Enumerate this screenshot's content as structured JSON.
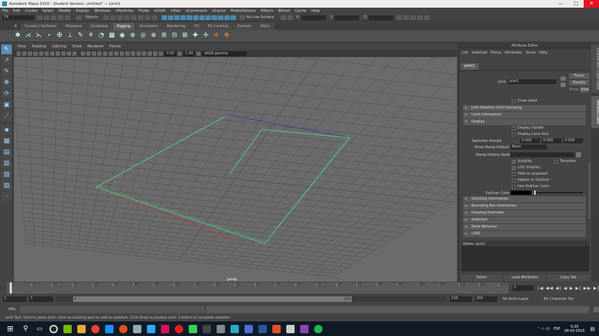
{
  "title": "Autodesk Maya 2016 - Student Version: untitled*   ---   joint1",
  "window_controls": {
    "min": "—",
    "max": "□",
    "close": "✕"
  },
  "menubar": [
    "File",
    "Edit",
    "Create",
    "Select",
    "Modify",
    "Display",
    "Windows",
    "nParticles",
    "Fluids",
    "nCloth",
    "nHair",
    "nConstraint",
    "nCache",
    "Fields/Solvers",
    "Effects",
    "Bifrost",
    "Cache",
    "Help"
  ],
  "status": {
    "menuset": "FX",
    "objects": "Objects",
    "live": "No Live Surface",
    "x_label": "X:",
    "y_label": "Y:",
    "z_label": "Z:"
  },
  "shelf_tabs": [
    "Curves / Surfaces",
    "Polygons",
    "Sculpting",
    "Rigging",
    "Animation",
    "Rendering",
    "FX",
    "FX Caching",
    "Custom",
    "XGen"
  ],
  "active_shelf_tab": "Rigging",
  "shelf_icons": [
    "joint",
    "ik",
    "ik-spline",
    "bind",
    "smooth-bind",
    "rigid",
    "paint",
    "blend",
    "cluster",
    "lattice",
    "wrap",
    "point",
    "aim",
    "orient",
    "scale",
    "parent",
    "pole",
    "locator",
    "curve",
    "move",
    "move-pivot"
  ],
  "panel_menu": [
    "View",
    "Shading",
    "Lighting",
    "Show",
    "Renderer",
    "Panels"
  ],
  "viewbar": {
    "value_a": "0.00",
    "value_b": "1.00",
    "color_mgmt": "sRGB gamma"
  },
  "viewport": {
    "camera": "persp"
  },
  "attribute_editor": {
    "title": "Attribute Editor",
    "menu": [
      "List",
      "Selected",
      "Focus",
      "Attributes",
      "Show",
      "Help"
    ],
    "node_tab": "joint1",
    "joint_label": "joint:",
    "joint_value": "joint1",
    "focus": "Focus",
    "presets": "Presets",
    "show": "Show",
    "hide": "Hide",
    "draw_label": "Draw Label",
    "sections_top": [
      "Joint Rotation Limit Damping",
      "Limit Information",
      "Display"
    ],
    "display_handle": "Display Handle",
    "display_local_axis": "Display Local Axis",
    "selection_handle_label": "Selection Handle",
    "selection_handle": [
      "0.000",
      "0.000",
      "0.000"
    ],
    "show_manip_label": "Show Manip Default",
    "show_manip_value": "None",
    "manip_history_label": "Manip History Node",
    "visibility": "Visibility",
    "template": "Template",
    "lod_visibility": "LOD Visibility",
    "hide_on_playback": "Hide on playback",
    "hidden_in_outliner": "Hidden In Outliner",
    "use_outliner_color": "Use Outliner Color",
    "outliner_color": "Outliner Color",
    "sections_bottom": [
      "Ghosting Information",
      "Bounding Box Information",
      "Drawing Overrides",
      "Selection",
      "Node Behavior",
      "UUID"
    ],
    "notes": "Notes:  joint1",
    "bottom_buttons": [
      "Select",
      "Load Attributes",
      "Copy Tab"
    ]
  },
  "side_tabs": [
    "Channel Box / Layer Editor",
    "Attribute Editor"
  ],
  "timeline": {
    "ticks": [
      "1",
      "5",
      "10",
      "15",
      "20",
      "25",
      "30",
      "35",
      "40",
      "45",
      "50",
      "55",
      "60",
      "65",
      "70",
      "75",
      "80",
      "85",
      "90",
      "95",
      "100",
      "105",
      "110",
      "115",
      "120"
    ],
    "current_frame": "1"
  },
  "range": {
    "start": "1",
    "playback_start": "1",
    "range_left": "1",
    "range_right": "120",
    "playback_end": "120",
    "end": "200",
    "anim_layer": "No Anim Layer",
    "char_set": "No Character Set"
  },
  "cmdline": {
    "lang": "MEL"
  },
  "helpline": "Joint Tool: Click to place joint. Click on existing joint to add to skeleton. Click-Drag to position joint. Confirm to complete skeleton.",
  "tray": {
    "lang": "ESP",
    "time": "0:20",
    "date": "09-03-2016"
  },
  "colors": {
    "viewport": "#6b6b6b",
    "grid": "#4e4e4e",
    "joint": "#4fd08a",
    "axis_red": "#c33",
    "axis_blue": "#33b"
  }
}
